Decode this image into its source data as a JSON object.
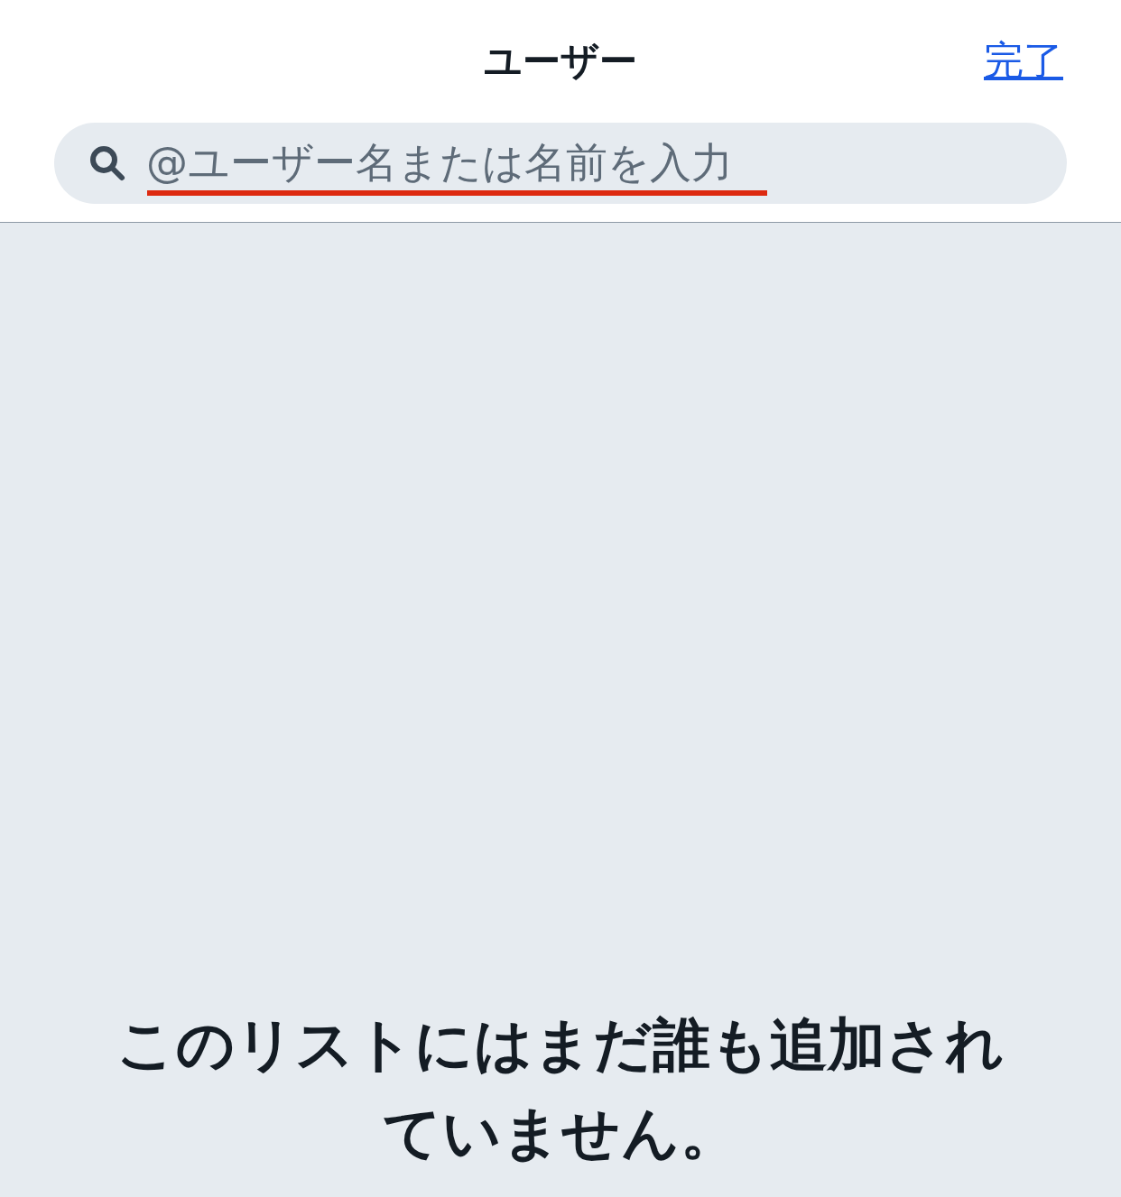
{
  "header": {
    "title": "ユーザー",
    "done_link": "完了"
  },
  "search": {
    "placeholder": "@ユーザー名または名前を入力"
  },
  "empty_message": "このリストにはまだ誰も追加されていません。"
}
